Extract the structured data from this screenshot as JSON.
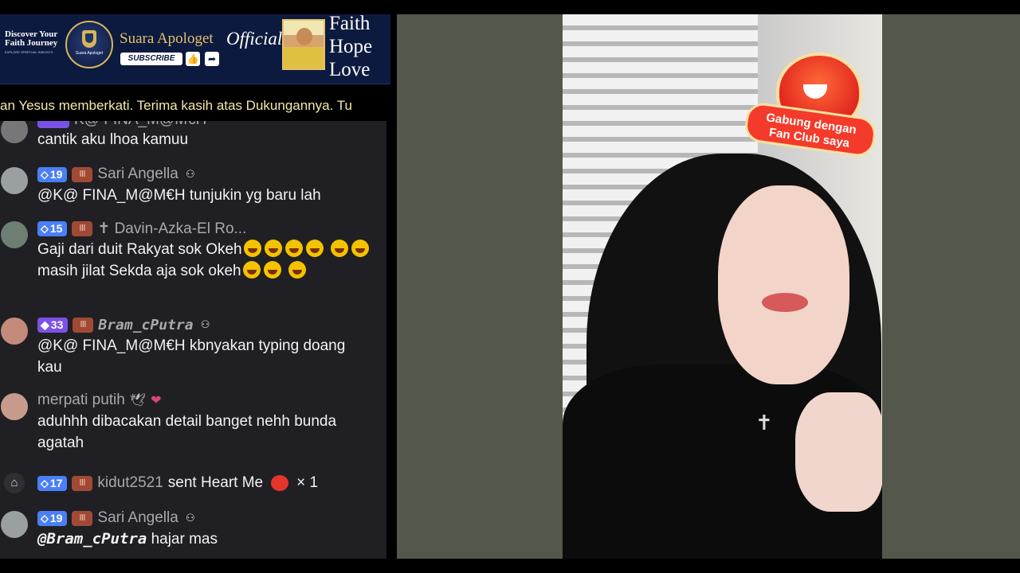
{
  "banner": {
    "tagline": "Discover Your Faith Journey",
    "tagline_small": "EXPLORE SPIRITUAL INSIGHTS",
    "logo_text": "Suara Apologet",
    "channel_name": "Suara Apologet",
    "official": "Official",
    "subscribe_label": "SUBSCRIBE",
    "motto": [
      "Faith",
      "Hope",
      "Love"
    ]
  },
  "ticker": "an Yesus memberkati.    Terima kasih atas Dukungannya. Tu",
  "chat": [
    {
      "level": "",
      "fan": "",
      "user": "K@ FINA_M@M€H",
      "mod": false,
      "text": "cantik aku lhoa kamuu"
    },
    {
      "level": "19",
      "fan": "lll",
      "user": "Sari Angella",
      "mod": true,
      "text": "@K@ FINA_M@M€H tunjukin yg baru lah"
    },
    {
      "level": "15",
      "fan": "lll",
      "user": "✝ Davin-Azka-El Ro...",
      "mod": false,
      "text_parts": [
        "Gaji dari duit Rakyat sok Okeh",
        "masih jilat Sekda aja sok okeh"
      ]
    },
    {
      "level": "33",
      "fan": "lll",
      "user": "Bram_cPutra",
      "mod": true,
      "text": "@K@ FINA_M@M€H kbnyakan typing doang kau"
    },
    {
      "level": "",
      "fan": "",
      "user": "merpati putih",
      "mod": false,
      "text": "aduhhh dibacakan detail banget nehh bunda agatah"
    },
    {
      "level": "17",
      "fan": "lll",
      "user": "kidut2521",
      "gift_text": "sent Heart Me",
      "gift_count": "× 1"
    },
    {
      "level": "19",
      "fan": "lll",
      "user": "Sari Angella",
      "mod": true,
      "mention": "@Bram_cPutra",
      "text": "hajar mas"
    }
  ],
  "fanclub": {
    "label_line1": "Gabung dengan",
    "label_line2": "Fan Club saya"
  },
  "colors": {
    "chat_bg": "#202024",
    "level_badge": "#4a7ff7",
    "level_badge_purple": "#7b52e8",
    "banner_bg": "#0d1a3f"
  }
}
